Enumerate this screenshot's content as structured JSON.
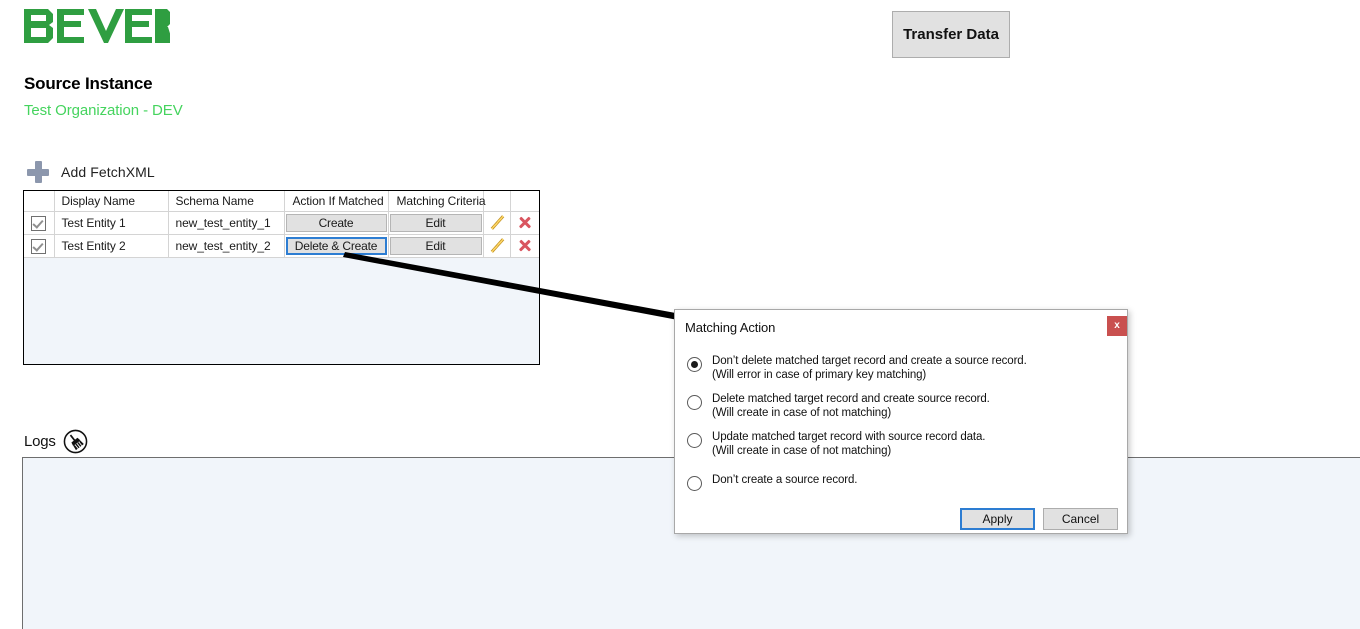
{
  "app": {
    "logo_text": "BEVER",
    "logo_color": "#2f9e41"
  },
  "header": {
    "transfer_data_label": "Transfer Data"
  },
  "source": {
    "title": "Source Instance",
    "organization": "Test Organization - DEV",
    "organization_color": "#45d45e"
  },
  "toolbar": {
    "add_fetchxml_label": "Add FetchXML"
  },
  "grid": {
    "columns": [
      "",
      "Display Name",
      "Schema Name",
      "Action If Matched",
      "Matching Criteria",
      "",
      ""
    ],
    "rows": [
      {
        "checked": true,
        "display_name": "Test Entity 1",
        "schema_name": "new_test_entity_1",
        "action_if_matched": "Create",
        "matching_criteria": "Edit",
        "action_focused": false
      },
      {
        "checked": true,
        "display_name": "Test Entity 2",
        "schema_name": "new_test_entity_2",
        "action_if_matched": "Delete & Create",
        "matching_criteria": "Edit",
        "action_focused": true
      }
    ]
  },
  "logs": {
    "label": "Logs",
    "clear_icon": "broom-icon",
    "content": ""
  },
  "dialog": {
    "title": "Matching Action",
    "close_label": "x",
    "close_color": "#c9504f",
    "options": [
      {
        "selected": true,
        "main": "Don’t delete matched target record and create a source record.",
        "sub": "(Will error in case of primary key matching)"
      },
      {
        "selected": false,
        "main": "Delete matched target record and create source record.",
        "sub": "(Will create in case of not matching)"
      },
      {
        "selected": false,
        "main": "Update matched target record with source record data.",
        "sub": "(Will create in case of not matching)"
      },
      {
        "selected": false,
        "main": "Don’t create a source record.",
        "sub": ""
      }
    ],
    "apply_label": "Apply",
    "cancel_label": "Cancel"
  }
}
